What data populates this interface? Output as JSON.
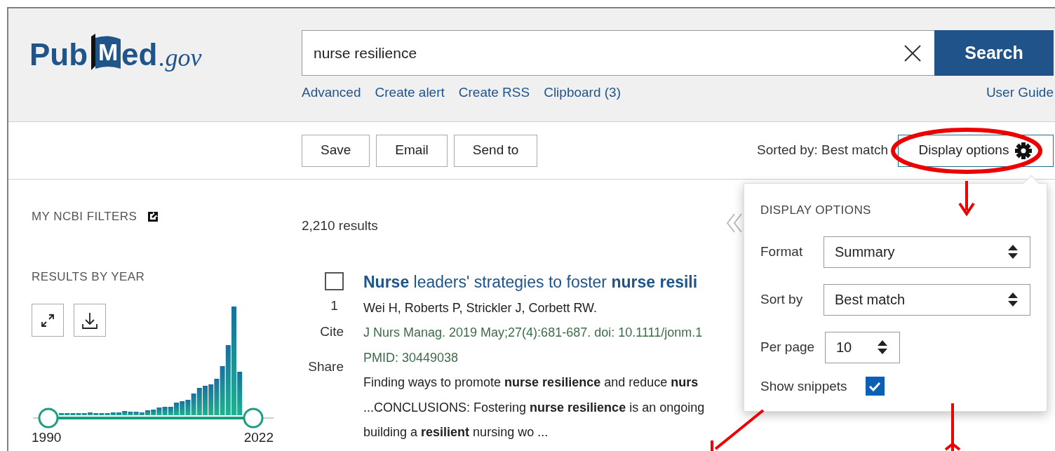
{
  "logo": {
    "pub": "Pub",
    "med_initial": "M",
    "med_rest": "ed",
    "domain": ".gov"
  },
  "search": {
    "value": "nurse resilience",
    "button": "Search"
  },
  "search_links": [
    "Advanced",
    "Create alert",
    "Create RSS",
    "Clipboard (3)"
  ],
  "user_guide": "User Guide",
  "actions": [
    "Save",
    "Email",
    "Send to"
  ],
  "sorted_by": "Sorted by: Best match",
  "display_options_button": "Display options",
  "sidebar": {
    "filters_title": "MY NCBI FILTERS",
    "results_by_year_title": "RESULTS BY YEAR",
    "year_start": "1990",
    "year_end": "2022"
  },
  "results_count": "2,210 results",
  "results": [
    {
      "index": "1",
      "checked": false,
      "title": "**Nurse** leaders' strategies to foster **nurse resili**",
      "authors": "Wei H, Roberts P, Strickler J, Corbett RW.",
      "citation": "J Nurs Manag. 2019 May;27(4):681-687. doi: 10.1111/jonm.1",
      "pmid": "PMID: 30449038",
      "actions": [
        "Cite",
        "Share"
      ],
      "snippets": [
        "Finding ways to promote **nurse resilience** and reduce **nurs**",
        "...CONCLUSIONS: Fostering **nurse resilience** is an ongoing",
        "building a **resilient** nursing wo ..."
      ]
    }
  ],
  "display_options": {
    "title": "DISPLAY OPTIONS",
    "fields": [
      {
        "label": "Format",
        "value": "Summary",
        "kind": "wide"
      },
      {
        "label": "Sort by",
        "value": "Best match",
        "kind": "wide"
      },
      {
        "label": "Per page",
        "value": "10",
        "kind": "narrow"
      }
    ],
    "show_snippets": {
      "label": "Show snippets",
      "checked": true
    }
  }
}
